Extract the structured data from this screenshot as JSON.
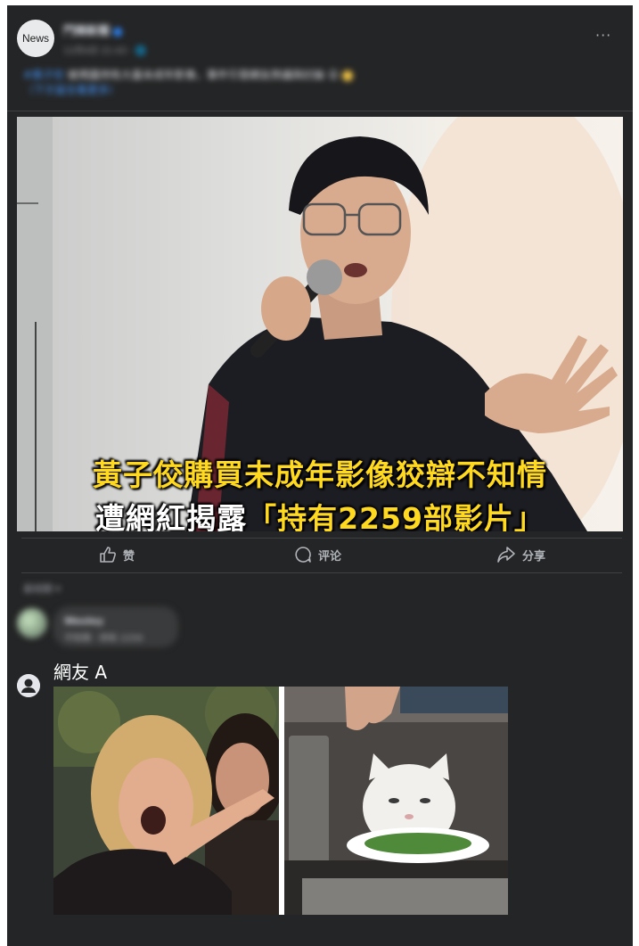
{
  "header": {
    "avatar_label": "News",
    "page_name": "鬥陣新聞",
    "post_meta": "12月4日 21:43 · 🌐",
    "more_icon": "more-horizontal-icon"
  },
  "caption": {
    "tag": "#黃子佼",
    "text": "被揭露持有大量未成年影像，事件引發網友熱議與討論 😮",
    "subline": "（下方留言看更多）"
  },
  "image": {
    "headline_line1": "黃子佼購買未成年影像狡辯不知情",
    "headline_line2_pre": "遭網紅揭露",
    "headline_line2_hl": "「持有2259部影片」"
  },
  "actions": {
    "like_label": "赞",
    "comment_label": "评论",
    "share_label": "分享"
  },
  "comments": {
    "sort_label": "最相關 ▾",
    "first": {
      "name": "Wesley",
      "text": "不知情 · 持有 2259"
    },
    "second": {
      "name": "網友 A"
    }
  },
  "colors": {
    "background": "#242526",
    "headline_yellow": "#ffd820",
    "link_blue": "#4599ff"
  }
}
